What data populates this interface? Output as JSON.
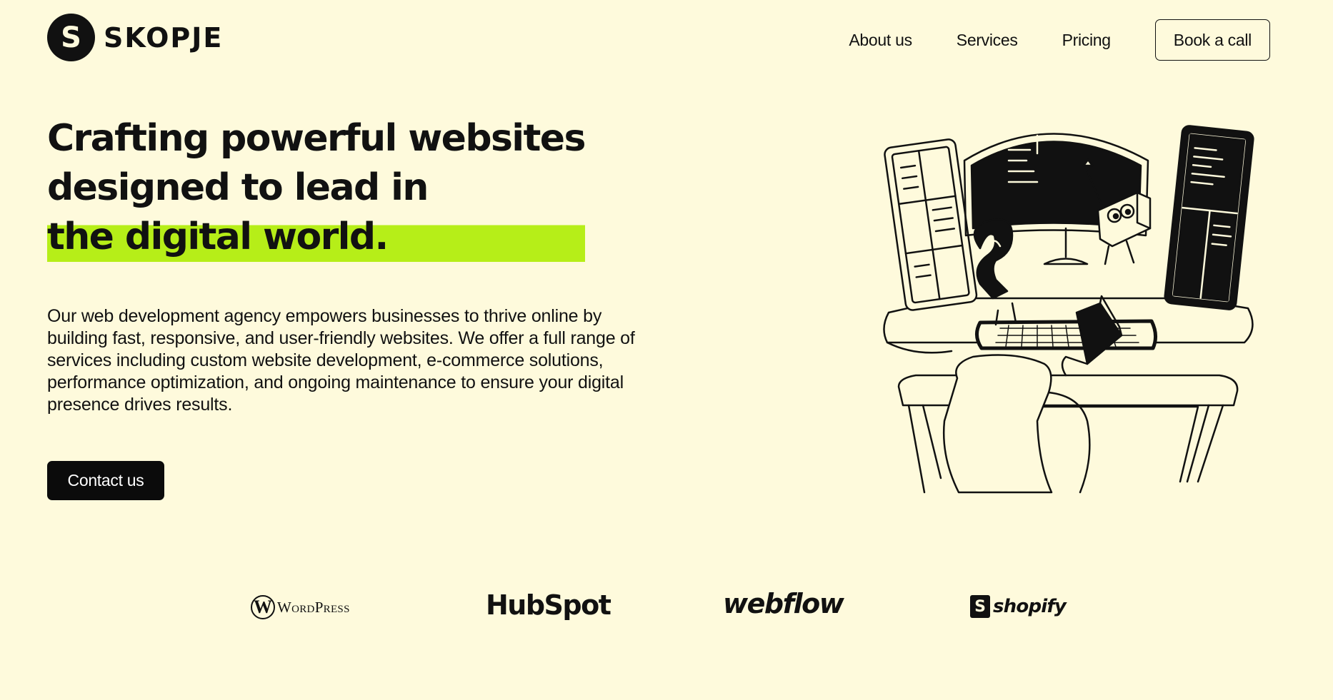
{
  "header": {
    "logo_letter": "S",
    "logo_text": "SKOPJE",
    "nav": [
      "About us",
      "Services",
      "Pricing"
    ],
    "cta_label": "Book a call"
  },
  "hero": {
    "title_line1": "Crafting powerful websites",
    "title_line2": "designed to lead in",
    "title_line3": "the digital world.",
    "description": "Our web development agency empowers businesses to thrive online by building fast, responsive, and user-friendly websites. We offer a full range of services including custom website development, e-commerce solutions, performance optimization, and ongoing maintenance to ensure your digital presence drives results.",
    "button_label": "Contact us",
    "highlight_color": "#b6ee18"
  },
  "brands": {
    "wordpress": "WordPress",
    "hubspot": "HubSpot",
    "webflow": "webflow",
    "shopify": "shopify"
  },
  "colors": {
    "background": "#fefadc",
    "text": "#111111",
    "accent": "#b6ee18"
  }
}
